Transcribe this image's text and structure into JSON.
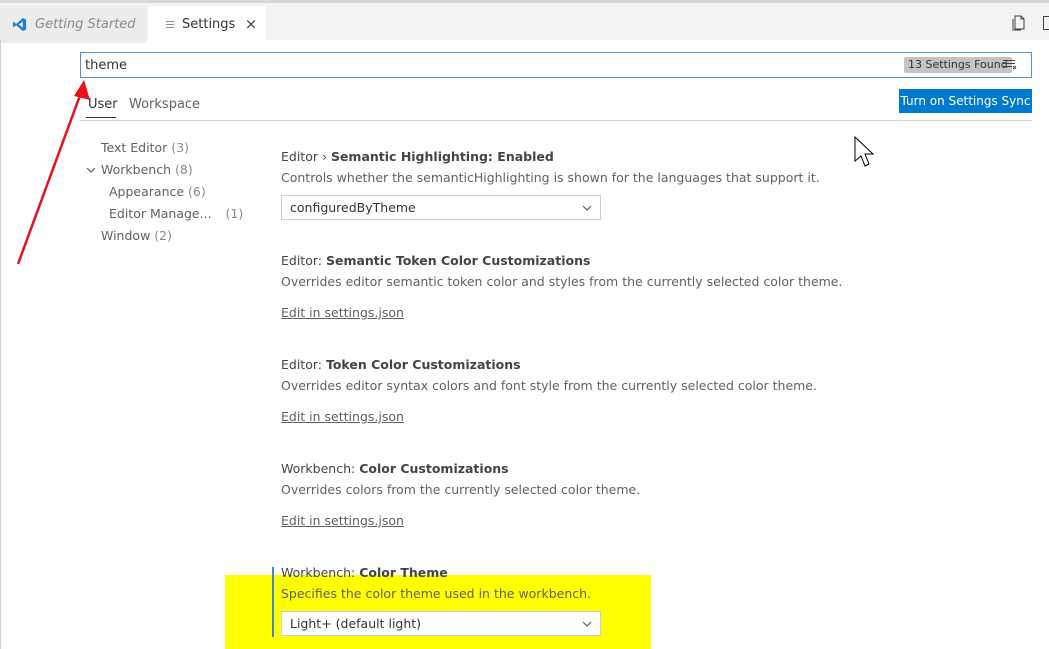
{
  "tabs": {
    "getting_started": "Getting Started",
    "settings": "Settings",
    "close": "×"
  },
  "search": {
    "value": "theme",
    "count_label": "13 Settings Found"
  },
  "scopes": {
    "user": "User",
    "workspace": "Workspace"
  },
  "sync_button": "Turn on Settings Sync",
  "toc": {
    "text_editor": "Text Editor",
    "text_editor_count": "(3)",
    "workbench": "Workbench",
    "workbench_count": "(8)",
    "appearance": "Appearance",
    "appearance_count": "(6)",
    "editor_management": "Editor Manage...",
    "editor_management_count": "(1)",
    "window": "Window",
    "window_count": "(2)"
  },
  "settings": [
    {
      "category": "Editor › ",
      "key": "Semantic Highlighting: Enabled",
      "description": "Controls whether the semanticHighlighting is shown for the languages that support it.",
      "value": "configuredByTheme"
    },
    {
      "category": "Editor: ",
      "key": "Semantic Token Color Customizations",
      "description": "Overrides editor semantic token color and styles from the currently selected color theme.",
      "link": "Edit in settings.json"
    },
    {
      "category": "Editor: ",
      "key": "Token Color Customizations",
      "description": "Overrides editor syntax colors and font style from the currently selected color theme.",
      "link": "Edit in settings.json"
    },
    {
      "category": "Workbench: ",
      "key": "Color Customizations",
      "description": "Overrides colors from the currently selected color theme.",
      "link": "Edit in settings.json"
    },
    {
      "category": "Workbench: ",
      "key": "Color Theme",
      "description": "Specifies the color theme used in the workbench.",
      "value": "Light+ (default light)"
    }
  ],
  "colors": {
    "accent": "#007acc",
    "highlight": "#ffff00",
    "annotation_arrow": "#e8111b"
  },
  "icons": {
    "vscode_logo": "vscode-logo-icon",
    "settings_tab": "list-lines-icon",
    "close": "close-icon",
    "split_editor": "split-editor-icon",
    "filter": "filter-lines-icon",
    "chevron": "chevron-down-icon",
    "cursor": "mouse-pointer-icon"
  }
}
